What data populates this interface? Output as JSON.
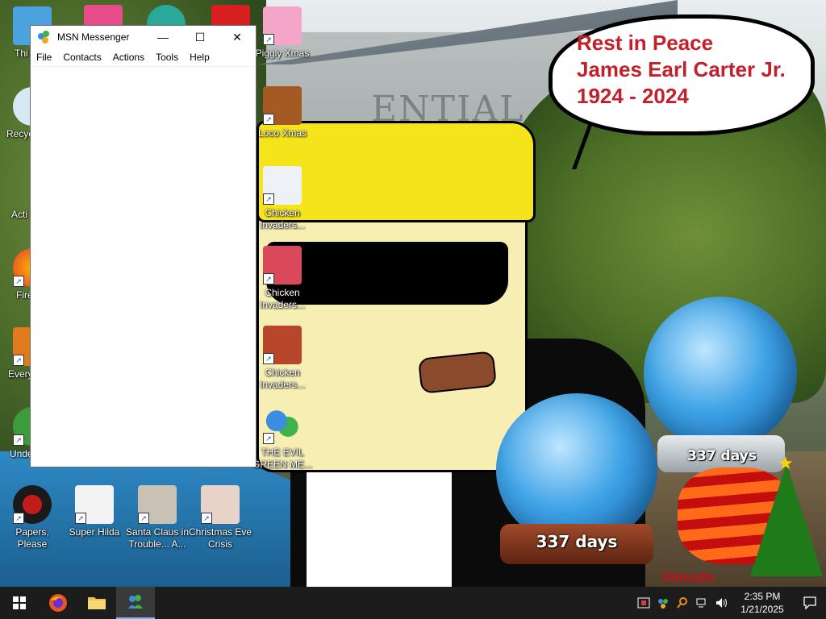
{
  "wallpaper": {
    "speech_bubble": [
      "Rest in Peace",
      "James Earl Carter Jr.",
      "1924 - 2024"
    ],
    "building_sign": "ENTIAL",
    "countdown_globes": [
      "337 days",
      "337 days"
    ],
    "watermark": "Vimodo"
  },
  "desktop_icons": [
    {
      "label": "Thi",
      "icon": "computer-icon"
    },
    {
      "label": "Recyc",
      "icon": "recycle-bin-icon"
    },
    {
      "label": "Acti",
      "icon": "app-icon"
    },
    {
      "label": "Fire",
      "icon": "firefox-icon"
    },
    {
      "label": "Every",
      "icon": "app-icon"
    },
    {
      "label": "Unde",
      "icon": "app-icon"
    },
    {
      "label": "Piggly Xmas",
      "icon": "pig-santa-icon"
    },
    {
      "label": "Loco Xmas",
      "icon": "teddy-bear-icon"
    },
    {
      "label": "Chicken Invaders...",
      "icon": "chicken-icon"
    },
    {
      "label": "Chicken Invaders...",
      "icon": "chicken-ship-icon"
    },
    {
      "label": "Chicken Invaders...",
      "icon": "chicken-icon"
    },
    {
      "label": "THE EVIL GREEN ME...",
      "icon": "msn-people-icon"
    },
    {
      "label": "Papers, Please",
      "icon": "seal-icon"
    },
    {
      "label": "Super Hilda",
      "icon": "pixel-cat-icon"
    },
    {
      "label": "Santa Claus in Trouble... A...",
      "icon": "santa-icon"
    },
    {
      "label": "Christmas Eve Crisis",
      "icon": "santa-icon"
    }
  ],
  "msn_window": {
    "title": "MSN Messenger",
    "menu": [
      "File",
      "Contacts",
      "Actions",
      "Tools",
      "Help"
    ],
    "controls": {
      "minimize": "—",
      "maximize": "☐",
      "close": "✕"
    }
  },
  "taskbar": {
    "start": "⊞",
    "pinned": [
      "firefox-icon",
      "file-explorer-icon",
      "msn-messenger-icon"
    ],
    "tray": [
      "security-icon",
      "msn-tray-icon",
      "search-tray-icon",
      "network-icon",
      "volume-icon"
    ],
    "clock": {
      "time": "2:35 PM",
      "date": "1/21/2025"
    },
    "notification": "🗨"
  },
  "colors": {
    "taskbar": "#1c1c1c",
    "bubble_text": "#c2202a",
    "msn_blue": "#1a56c2"
  }
}
